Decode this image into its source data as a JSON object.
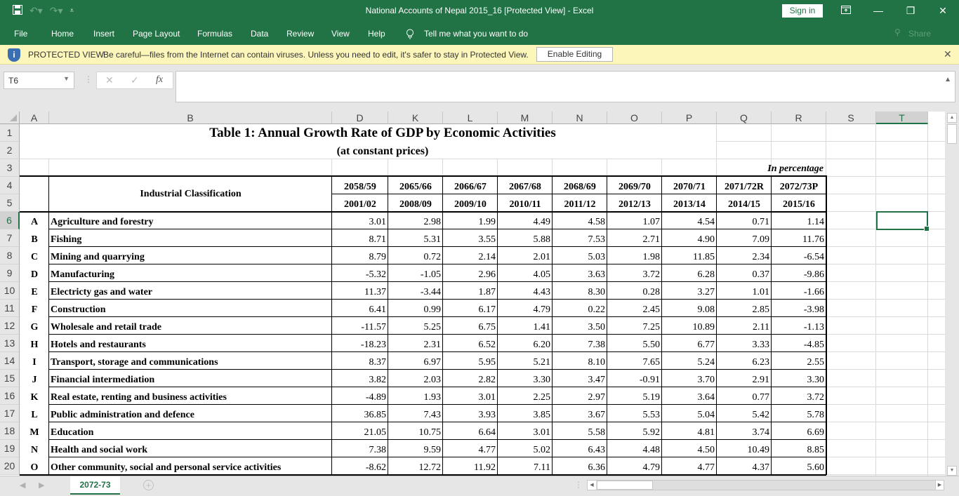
{
  "window": {
    "title": "National Accounts of Nepal 2015_16  [Protected View]  -  Excel",
    "sign_in": "Sign in",
    "icons": {
      "save": "save-icon",
      "undo": "undo-icon",
      "redo": "redo-icon",
      "customize": "customize-qat-icon",
      "ribbon_display": "ribbon-display-options-icon",
      "minimize": "minimize-icon",
      "restore": "restore-icon",
      "close": "close-icon"
    }
  },
  "ribbon": {
    "tabs": [
      "File",
      "Home",
      "Insert",
      "Page Layout",
      "Formulas",
      "Data",
      "Review",
      "View",
      "Help"
    ],
    "tell_me": "Tell me what you want to do",
    "share": "Share"
  },
  "protected_view": {
    "label": "PROTECTED VIEW",
    "message": "Be careful—files from the Internet can contain viruses. Unless you need to edit, it's safer to stay in Protected View.",
    "enable_button": "Enable Editing",
    "close": "✕"
  },
  "formula_bar": {
    "name_box": "T6",
    "formula": "",
    "fx_label": "fx"
  },
  "columns": [
    "A",
    "B",
    "D",
    "K",
    "L",
    "M",
    "N",
    "O",
    "P",
    "Q",
    "R",
    "S",
    "T"
  ],
  "selected_cell": {
    "column": "T",
    "row": 6
  },
  "sheet": {
    "title": "Table 1: Annual Growth Rate of GDP by Economic Activities",
    "subtitle": "(at constant prices)",
    "unit_note": "In percentage",
    "classification_header": "Industrial Classification",
    "years_bs": [
      "2058/59",
      "2065/66",
      "2066/67",
      "2067/68",
      "2068/69",
      "2069/70",
      "2070/71",
      "2071/72R",
      "2072/73P"
    ],
    "years_ad": [
      "2001/02",
      "2008/09",
      "2009/10",
      "2010/11",
      "2011/12",
      "2012/13",
      "2013/14",
      "2014/15",
      "2015/16"
    ],
    "rows": [
      {
        "code": "A",
        "name": "Agriculture and forestry",
        "values": [
          "3.01",
          "2.98",
          "1.99",
          "4.49",
          "4.58",
          "1.07",
          "4.54",
          "0.71",
          "1.14"
        ]
      },
      {
        "code": "B",
        "name": "Fishing",
        "values": [
          "8.71",
          "5.31",
          "3.55",
          "5.88",
          "7.53",
          "2.71",
          "4.90",
          "7.09",
          "11.76"
        ]
      },
      {
        "code": "C",
        "name": "Mining and quarrying",
        "values": [
          "8.79",
          "0.72",
          "2.14",
          "2.01",
          "5.03",
          "1.98",
          "11.85",
          "2.34",
          "-6.54"
        ]
      },
      {
        "code": "D",
        "name": "Manufacturing",
        "values": [
          "-5.32",
          "-1.05",
          "2.96",
          "4.05",
          "3.63",
          "3.72",
          "6.28",
          "0.37",
          "-9.86"
        ]
      },
      {
        "code": "E",
        "name": "Electricty gas and water",
        "values": [
          "11.37",
          "-3.44",
          "1.87",
          "4.43",
          "8.30",
          "0.28",
          "3.27",
          "1.01",
          "-1.66"
        ]
      },
      {
        "code": "F",
        "name": "Construction",
        "values": [
          "6.41",
          "0.99",
          "6.17",
          "4.79",
          "0.22",
          "2.45",
          "9.08",
          "2.85",
          "-3.98"
        ]
      },
      {
        "code": "G",
        "name": "Wholesale and retail trade",
        "values": [
          "-11.57",
          "5.25",
          "6.75",
          "1.41",
          "3.50",
          "7.25",
          "10.89",
          "2.11",
          "-1.13"
        ]
      },
      {
        "code": "H",
        "name": "Hotels and restaurants",
        "values": [
          "-18.23",
          "2.31",
          "6.52",
          "6.20",
          "7.38",
          "5.50",
          "6.77",
          "3.33",
          "-4.85"
        ]
      },
      {
        "code": "I",
        "name": "Transport, storage and communications",
        "values": [
          "8.37",
          "6.97",
          "5.95",
          "5.21",
          "8.10",
          "7.65",
          "5.24",
          "6.23",
          "2.55"
        ]
      },
      {
        "code": "J",
        "name": "Financial intermediation",
        "values": [
          "3.82",
          "2.03",
          "2.82",
          "3.30",
          "3.47",
          "-0.91",
          "3.70",
          "2.91",
          "3.30"
        ]
      },
      {
        "code": "K",
        "name": "Real estate, renting and business activities",
        "values": [
          "-4.89",
          "1.93",
          "3.01",
          "2.25",
          "2.97",
          "5.19",
          "3.64",
          "0.77",
          "3.72"
        ]
      },
      {
        "code": "L",
        "name": "Public administration and defence",
        "values": [
          "36.85",
          "7.43",
          "3.93",
          "3.85",
          "3.67",
          "5.53",
          "5.04",
          "5.42",
          "5.78"
        ]
      },
      {
        "code": "M",
        "name": "Education",
        "values": [
          "21.05",
          "10.75",
          "6.64",
          "3.01",
          "5.58",
          "5.92",
          "4.81",
          "3.74",
          "6.69"
        ]
      },
      {
        "code": "N",
        "name": "Health and social work",
        "values": [
          "7.38",
          "9.59",
          "4.77",
          "5.02",
          "6.43",
          "4.48",
          "4.50",
          "10.49",
          "8.85"
        ]
      },
      {
        "code": "O",
        "name": "Other community, social and personal service activities",
        "values": [
          "-8.62",
          "12.72",
          "11.92",
          "7.11",
          "6.36",
          "4.79",
          "4.77",
          "4.37",
          "5.60"
        ]
      }
    ]
  },
  "sheet_tabs": {
    "active": "2072-73",
    "add_label": "+"
  }
}
